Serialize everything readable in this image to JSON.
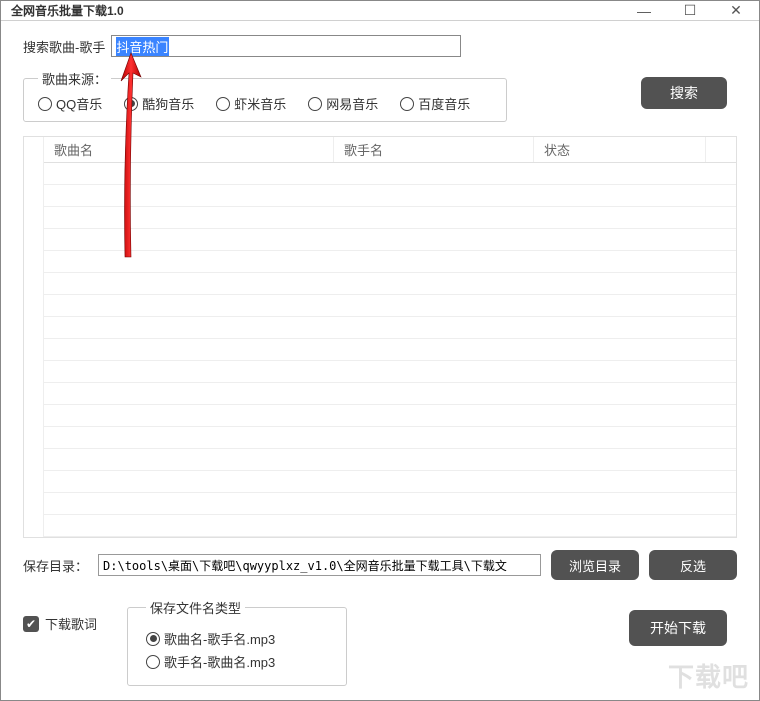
{
  "window": {
    "title": "全网音乐批量下载1.0",
    "buttons": {
      "min": "—",
      "max": "☐",
      "close": "✕"
    }
  },
  "search": {
    "label": "搜索歌曲-歌手",
    "value": "抖音热门",
    "button": "搜索"
  },
  "source": {
    "legend": "歌曲来源：",
    "options": [
      {
        "label": "QQ音乐",
        "checked": false
      },
      {
        "label": "酷狗音乐",
        "checked": true
      },
      {
        "label": "虾米音乐",
        "checked": false
      },
      {
        "label": "网易音乐",
        "checked": false
      },
      {
        "label": "百度音乐",
        "checked": false
      }
    ]
  },
  "table": {
    "columns": [
      "歌曲名",
      "歌手名",
      "状态"
    ]
  },
  "save": {
    "label": "保存目录：",
    "path": "D:\\tools\\桌面\\下载吧\\qwyyplxz_v1.0\\全网音乐批量下载工具\\下载文",
    "browse": "浏览目录",
    "invert": "反选"
  },
  "lyrics": {
    "label": "下载歌词",
    "checked": true
  },
  "filetype": {
    "legend": "保存文件名类型",
    "options": [
      {
        "label": "歌曲名-歌手名.mp3",
        "checked": true
      },
      {
        "label": "歌手名-歌曲名.mp3",
        "checked": false
      }
    ]
  },
  "start": {
    "label": "开始下载"
  },
  "watermark": "下载吧"
}
